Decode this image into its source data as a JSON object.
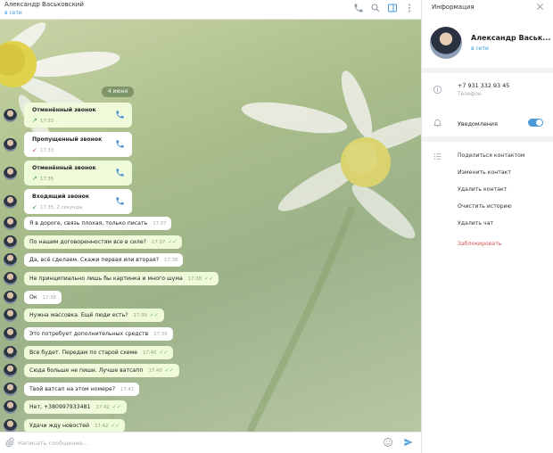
{
  "header": {
    "contact_name": "Александр Васьковский",
    "status": "в сети",
    "icons": [
      "phone-icon",
      "search-icon",
      "info-panel-icon",
      "more-icon"
    ]
  },
  "chat": {
    "date_separator": "4 июня",
    "calls": [
      {
        "title": "Отменённый звонок",
        "detail": "17:33",
        "direction": "outgoing",
        "status": "cancelled",
        "side": "out"
      },
      {
        "title": "Пропущенный звонок",
        "detail": "17:33",
        "direction": "incoming",
        "status": "missed",
        "side": "in"
      },
      {
        "title": "Отменённый звонок",
        "detail": "17:35",
        "direction": "outgoing",
        "status": "cancelled",
        "side": "out"
      },
      {
        "title": "Входящий звонок",
        "detail": "17:35, 2 секунды",
        "direction": "incoming",
        "status": "answered",
        "side": "in"
      }
    ],
    "messages": [
      {
        "text": "Я в дороге, связь плохая, только писать",
        "time": "17:37",
        "side": "in"
      },
      {
        "text": "По нашим договоренностям все в силе?",
        "time": "17:37",
        "side": "out"
      },
      {
        "text": "Да, всё сделаем. Скажи первая или вторая?",
        "time": "17:38",
        "side": "in"
      },
      {
        "text": "Не принципиально лишь бы картинка и много шума",
        "time": "17:38",
        "side": "out"
      },
      {
        "text": "Ок",
        "time": "17:38",
        "side": "in"
      },
      {
        "text": "Нужна массовка. Ещё люди есть?",
        "time": "17:39",
        "side": "out"
      },
      {
        "text": "Это потребует дополнительных средств",
        "time": "17:39",
        "side": "in"
      },
      {
        "text": "Все будет. Передам по старой схеме",
        "time": "17:40",
        "side": "out"
      },
      {
        "text": "Сюда больше не пиши. Лучше ватсапп",
        "time": "17:40",
        "side": "out"
      },
      {
        "text": "Твой ватсап на этом номере?",
        "time": "17:41",
        "side": "in"
      },
      {
        "text": "Нет, +380997933481",
        "time": "17:42",
        "side": "out"
      },
      {
        "text": "Удачи жду новостей",
        "time": "17:42",
        "side": "out"
      }
    ]
  },
  "input": {
    "placeholder": "Написать сообщение..."
  },
  "info_panel": {
    "title": "Информация",
    "name": "Александр Васьк...",
    "status": "в сети",
    "phone": "+7 931 332 93 45",
    "phone_label": "Телефон",
    "notifications_label": "Уведомления",
    "notifications_on": true,
    "actions": [
      {
        "label": "Поделиться контактом",
        "danger": false
      },
      {
        "label": "Изменить контакт",
        "danger": false
      },
      {
        "label": "Удалить контакт",
        "danger": false
      },
      {
        "label": "Очистить историю",
        "danger": false
      },
      {
        "label": "Удалить чат",
        "danger": false
      },
      {
        "label": "Заблокировать",
        "danger": true
      }
    ]
  },
  "colors": {
    "accent": "#4a9ad8",
    "out_bubble": "#eefad9",
    "in_bubble": "#ffffff",
    "danger": "#d9534f"
  }
}
